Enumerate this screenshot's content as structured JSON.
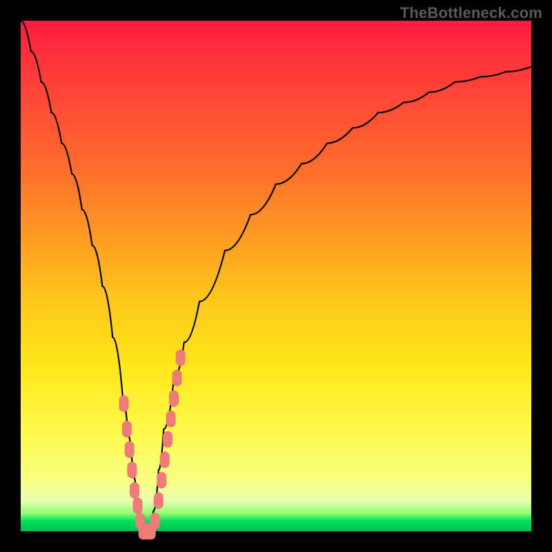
{
  "watermark": "TheBottleneck.com",
  "colors": {
    "frame": "#000000",
    "curve_stroke": "#000000",
    "marker_fill": "#f07a7a",
    "band_top": "#ff1a3f",
    "band_bottom": "#00c050"
  },
  "chart_data": {
    "type": "line",
    "title": "",
    "xlabel": "",
    "ylabel": "",
    "xlim": [
      0,
      100
    ],
    "ylim": [
      0,
      100
    ],
    "x": [
      0,
      2,
      4,
      6,
      8,
      10,
      12,
      14,
      16,
      18,
      20,
      21,
      22,
      23,
      24,
      25,
      26,
      27,
      28,
      30,
      32,
      35,
      40,
      45,
      50,
      55,
      60,
      65,
      70,
      75,
      80,
      85,
      90,
      95,
      100
    ],
    "y": [
      100,
      94,
      88,
      82,
      76,
      70,
      63,
      56,
      48,
      38,
      26,
      19,
      11,
      4,
      0,
      0,
      4,
      12,
      20,
      30,
      37,
      45,
      55,
      62,
      68,
      72,
      76,
      79,
      82,
      84,
      86,
      88,
      89,
      90,
      91
    ],
    "series": [
      {
        "name": "bottleneck-curve",
        "stroke": "#000000"
      }
    ],
    "markers": {
      "name": "highlighted-points",
      "fill": "#f07a7a",
      "points_x": [
        20.2,
        20.8,
        21.3,
        21.8,
        22.3,
        22.9,
        23.4,
        24.0,
        24.7,
        25.5,
        26.3,
        27.0,
        27.6,
        28.2,
        28.8,
        29.4,
        30.0,
        30.6,
        31.3
      ],
      "points_y": [
        25,
        20,
        16,
        12,
        8,
        5,
        2,
        0,
        0,
        0,
        2,
        6,
        10,
        14,
        18,
        22,
        26,
        30,
        34
      ]
    }
  }
}
